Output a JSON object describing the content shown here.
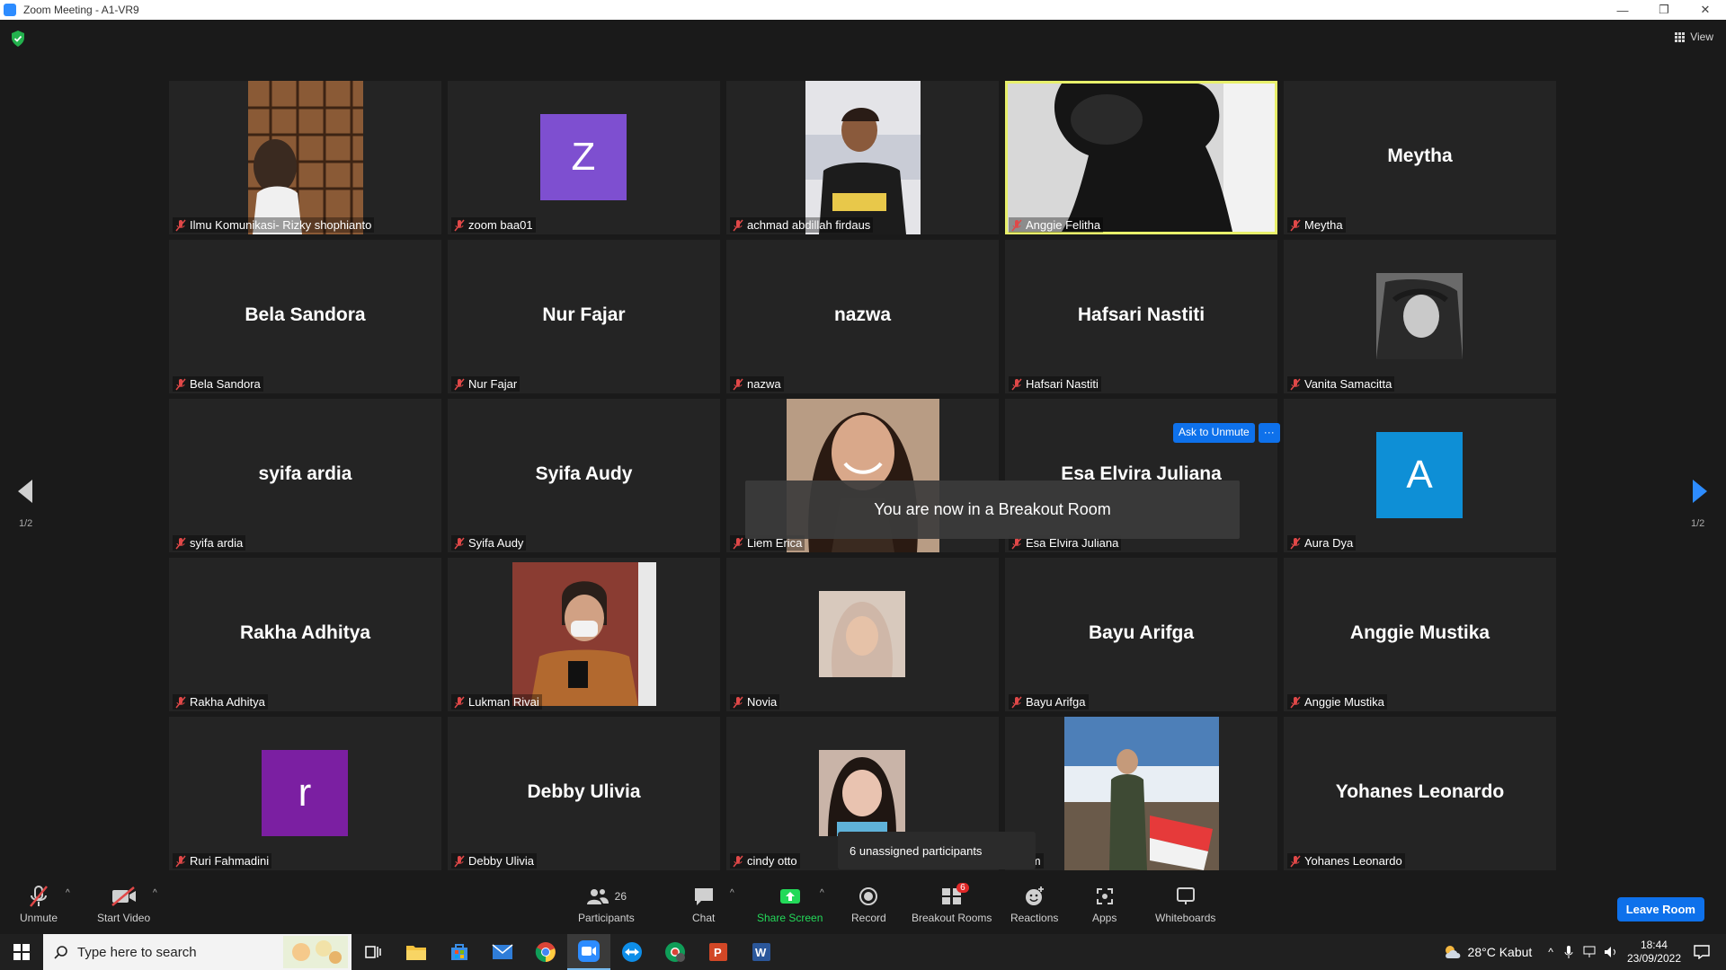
{
  "window": {
    "title": "Zoom Meeting - A1-VR9",
    "controls": [
      "—",
      "❐",
      "✕"
    ]
  },
  "header": {
    "view_label": "View"
  },
  "pager": {
    "left_label": "1/2",
    "right_label": "1/2"
  },
  "tiles": [
    {
      "label": "Ilmu Komunikasi- Rizky shophianto",
      "big": "",
      "avatar": "",
      "photo": "photo1"
    },
    {
      "label": "zoom baa01",
      "big": "",
      "avatar": "Z",
      "avatar_color": "#7e4fd0"
    },
    {
      "label": "achmad abdillah firdaus",
      "big": "",
      "avatar": "",
      "photo": "photo2"
    },
    {
      "label": "Anggie Felitha",
      "big": "",
      "avatar": "",
      "photo": "video-active"
    },
    {
      "label": "Meytha",
      "big": "Meytha",
      "avatar": ""
    },
    {
      "label": "Bela Sandora",
      "big": "Bela Sandora",
      "avatar": ""
    },
    {
      "label": "Nur Fajar",
      "big": "Nur Fajar",
      "avatar": ""
    },
    {
      "label": "nazwa",
      "big": "nazwa",
      "avatar": ""
    },
    {
      "label": "Hafsari Nastiti",
      "big": "Hafsari Nastiti",
      "avatar": ""
    },
    {
      "label": "Vanita Samacitta",
      "big": "",
      "avatar": "",
      "photo": "photo3"
    },
    {
      "label": "syifa ardia",
      "big": "syifa ardia",
      "avatar": ""
    },
    {
      "label": "Syifa Audy",
      "big": "Syifa Audy",
      "avatar": ""
    },
    {
      "label": "Liem Erica",
      "big": "",
      "avatar": "",
      "photo": "photo4"
    },
    {
      "label": "Esa Elvira Juliana",
      "big": "Esa Elvira Juliana",
      "avatar": ""
    },
    {
      "label": "Aura Dya",
      "big": "",
      "avatar": "A",
      "avatar_color": "#0e8fd6"
    },
    {
      "label": "Rakha Adhitya",
      "big": "Rakha Adhitya",
      "avatar": ""
    },
    {
      "label": "Lukman Rivai",
      "big": "",
      "avatar": "",
      "photo": "photo5"
    },
    {
      "label": "Novia",
      "big": "",
      "avatar": "",
      "photo": "photo6"
    },
    {
      "label": "Bayu Arifga",
      "big": "Bayu Arifga",
      "avatar": ""
    },
    {
      "label": "Anggie Mustika",
      "big": "Anggie Mustika",
      "avatar": ""
    },
    {
      "label": "Ruri Fahmadini",
      "big": "",
      "avatar": "r",
      "avatar_color": "#7b1fa2"
    },
    {
      "label": "Debby Ulivia",
      "big": "Debby Ulivia",
      "avatar": ""
    },
    {
      "label": "cindy otto",
      "big": "",
      "avatar": "",
      "photo": "photo7"
    },
    {
      "label": "dham",
      "big": "",
      "avatar": "",
      "photo": "photo8"
    },
    {
      "label": "Yohanes Leonardo",
      "big": "Yohanes Leonardo",
      "avatar": ""
    }
  ],
  "notifications": {
    "breakout_toast": "You are now in a Breakout Room",
    "ask_to_unmute": "Ask to Unmute",
    "more": "···",
    "unassigned": "6 unassigned participants"
  },
  "toolbar": {
    "unmute": "Unmute",
    "start_video": "Start Video",
    "participants": "Participants",
    "participants_count": "26",
    "chat": "Chat",
    "share_screen": "Share Screen",
    "record": "Record",
    "breakout_rooms": "Breakout Rooms",
    "breakout_badge": "6",
    "reactions": "Reactions",
    "apps": "Apps",
    "whiteboards": "Whiteboards",
    "leave_room": "Leave Room",
    "share_color": "#23d959",
    "leave_color": "#0e71eb"
  },
  "taskbar": {
    "search_placeholder": "Type here to search",
    "weather": "28°C  Kabut",
    "time": "18:44",
    "date": "23/09/2022"
  }
}
